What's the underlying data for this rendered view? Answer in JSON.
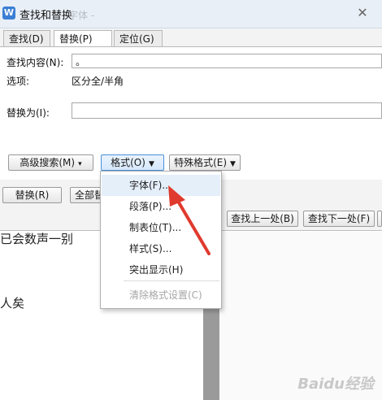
{
  "window": {
    "title": "查找和替换",
    "ghost_title": "字体 -"
  },
  "tabs": [
    {
      "label": "查找(D)"
    },
    {
      "label": "替换(P)"
    },
    {
      "label": "定位(G)"
    }
  ],
  "find": {
    "label": "查找内容(N):",
    "value": "。"
  },
  "options": {
    "label": "选项:",
    "value": "区分全/半角"
  },
  "replace": {
    "label": "替换为(I):",
    "value": ""
  },
  "buttons": {
    "advanced": "高级搜索(M)",
    "format": "格式(O)",
    "special": "特殊格式(E)",
    "replace": "替换(R)",
    "replace_all": "全部替",
    "find_prev": "查找上一处(B)",
    "find_next": "查找下一处(F)"
  },
  "format_menu": [
    {
      "label": "字体(F)..."
    },
    {
      "label": "段落(P)..."
    },
    {
      "label": "制表位(T)..."
    },
    {
      "label": "样式(S)..."
    },
    {
      "label": "突出显示(H)"
    },
    {
      "label": "清除格式设置(C)"
    }
  ],
  "document": {
    "line1": "已会数声一别",
    "line2": "人矣"
  },
  "watermark": "Baidu经验",
  "colors": {
    "accent": "#4a90d9",
    "arrow": "#e03a2e",
    "menu_highlight": "#e5effa"
  },
  "icons": {
    "app": "wps-writer-icon",
    "close": "close-icon",
    "caret": "caret-down-icon"
  }
}
